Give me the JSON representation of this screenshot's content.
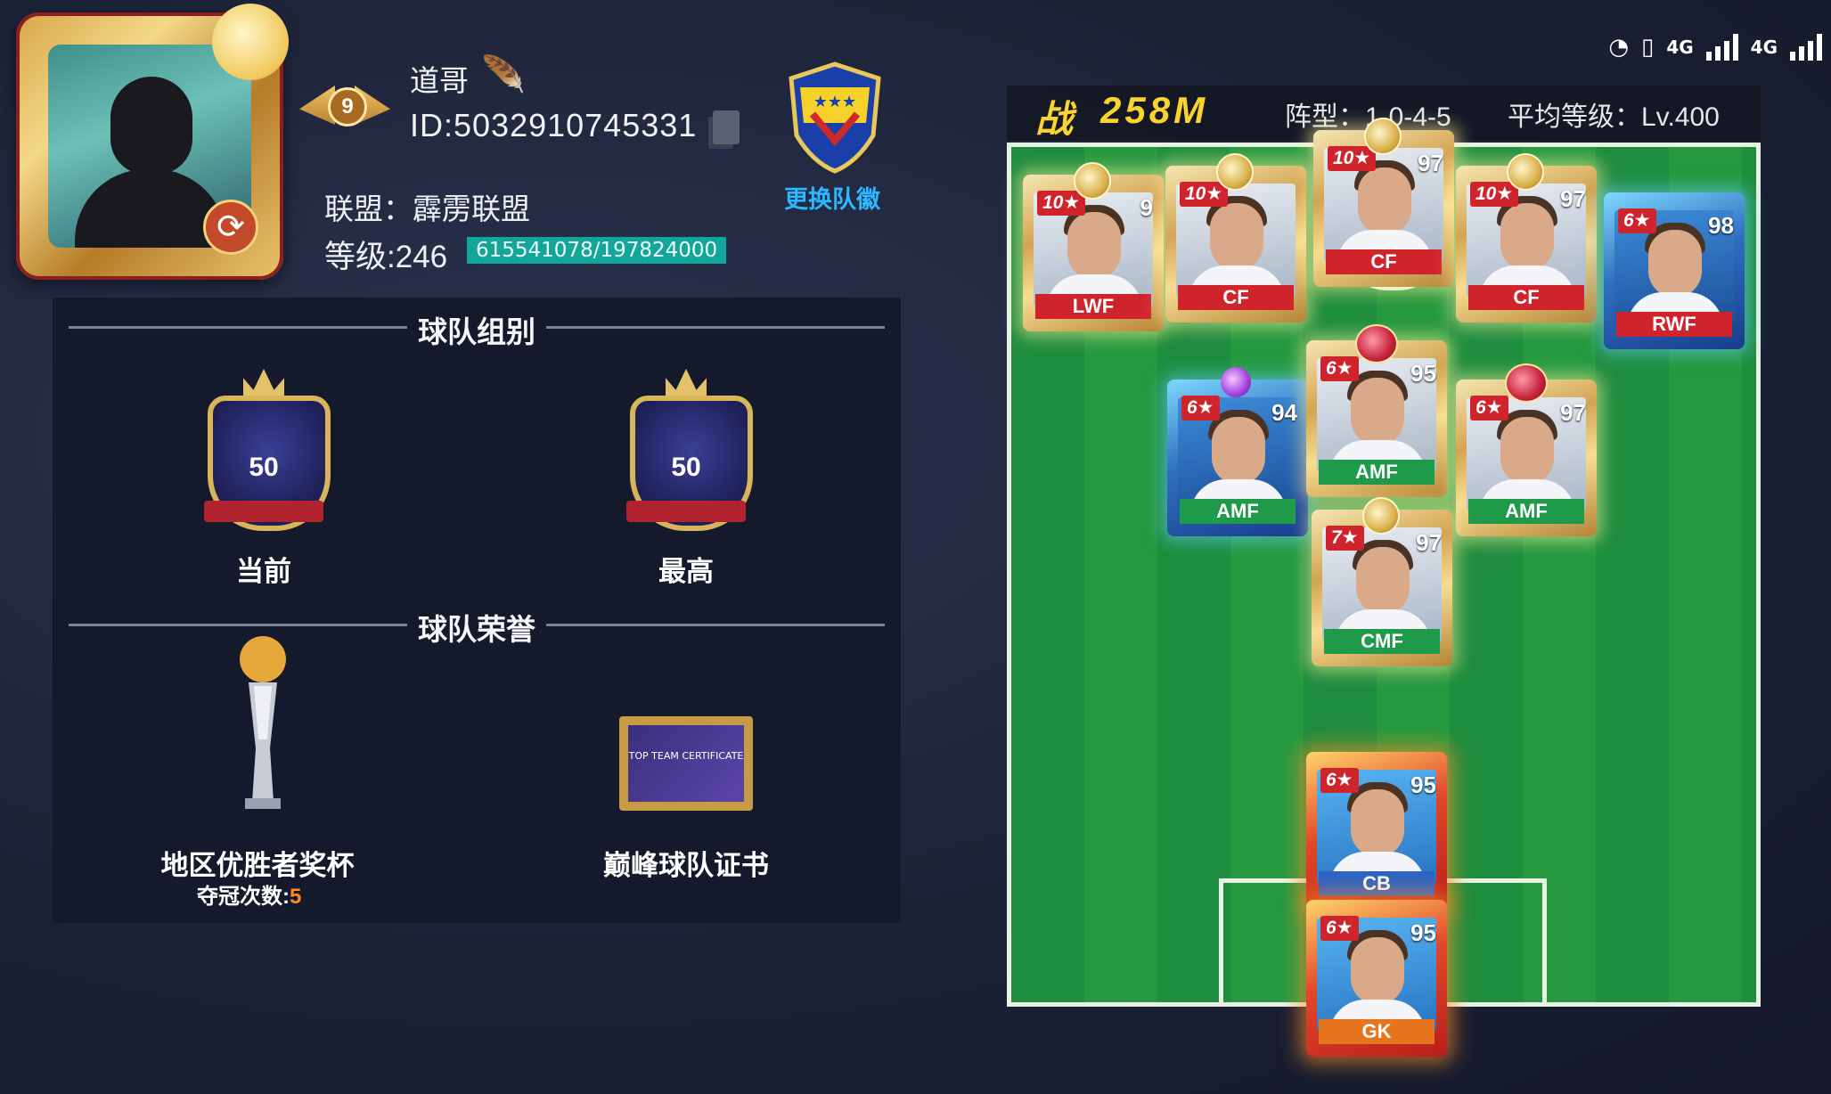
{
  "status_bar": {
    "icons": [
      "speed-icon",
      "vibrate-icon",
      "signal-icon",
      "signal-icon"
    ],
    "network1": "4G",
    "network2": "4G"
  },
  "profile": {
    "name": "道哥",
    "id": "ID:5032910745331",
    "league": "联盟：霹雳联盟",
    "level": "等级:246",
    "exp": "615541078/197824000",
    "rank_number": "9"
  },
  "emblem": {
    "change_label": "更换队徽"
  },
  "team_group": {
    "title": "球队组别",
    "current": {
      "value": "50",
      "label": "当前"
    },
    "highest": {
      "value": "50",
      "label": "最高"
    }
  },
  "team_honors": {
    "title": "球队荣誉",
    "trophy_label": "地区优胜者奖杯",
    "wins_label": "夺冠次数:",
    "wins_value": "5",
    "certificate_label": "巅峰球队证书",
    "certificate_text": "TOP TEAM CERTIFICATE"
  },
  "lineup": {
    "power_label": "战",
    "power_value": "258M",
    "formation": "阵型：1-0-4-5",
    "average_level": "平均等级：Lv.400",
    "players": [
      {
        "stars": "10★",
        "rating": "9",
        "position": "LWF",
        "style": "gold",
        "pos_color": "red",
        "top": "ball"
      },
      {
        "stars": "10★",
        "rating": "",
        "position": "CF",
        "style": "gold",
        "pos_color": "red",
        "top": "ball"
      },
      {
        "stars": "10★",
        "rating": "97",
        "position": "CF",
        "style": "gold",
        "pos_color": "red",
        "top": "ball"
      },
      {
        "stars": "10★",
        "rating": "97",
        "position": "CF",
        "style": "gold",
        "pos_color": "red",
        "top": "ball"
      },
      {
        "stars": "6★",
        "rating": "98",
        "position": "RWF",
        "style": "blue",
        "pos_color": "red",
        "top": ""
      },
      {
        "stars": "6★",
        "rating": "94",
        "position": "AMF",
        "style": "blue",
        "pos_color": "green",
        "top": "gem"
      },
      {
        "stars": "6★",
        "rating": "95",
        "position": "AMF",
        "style": "gold",
        "pos_color": "green",
        "top": "wc"
      },
      {
        "stars": "6★",
        "rating": "97",
        "position": "AMF",
        "style": "gold",
        "pos_color": "green",
        "top": "wc"
      },
      {
        "stars": "7★",
        "rating": "97",
        "position": "CMF",
        "style": "gold",
        "pos_color": "green",
        "top": "ball"
      },
      {
        "stars": "6★",
        "rating": "95",
        "position": "CB",
        "style": "red",
        "pos_color": "blue",
        "top": ""
      },
      {
        "stars": "6★",
        "rating": "95",
        "position": "GK",
        "style": "red",
        "pos_color": "orange",
        "top": ""
      }
    ]
  },
  "colors": {
    "power": "#f9d431",
    "exp_bg": "#14a59a",
    "emblem_label": "#2ab8ff",
    "wins": "#ff8a25",
    "pitch": "#1f8d3e"
  }
}
